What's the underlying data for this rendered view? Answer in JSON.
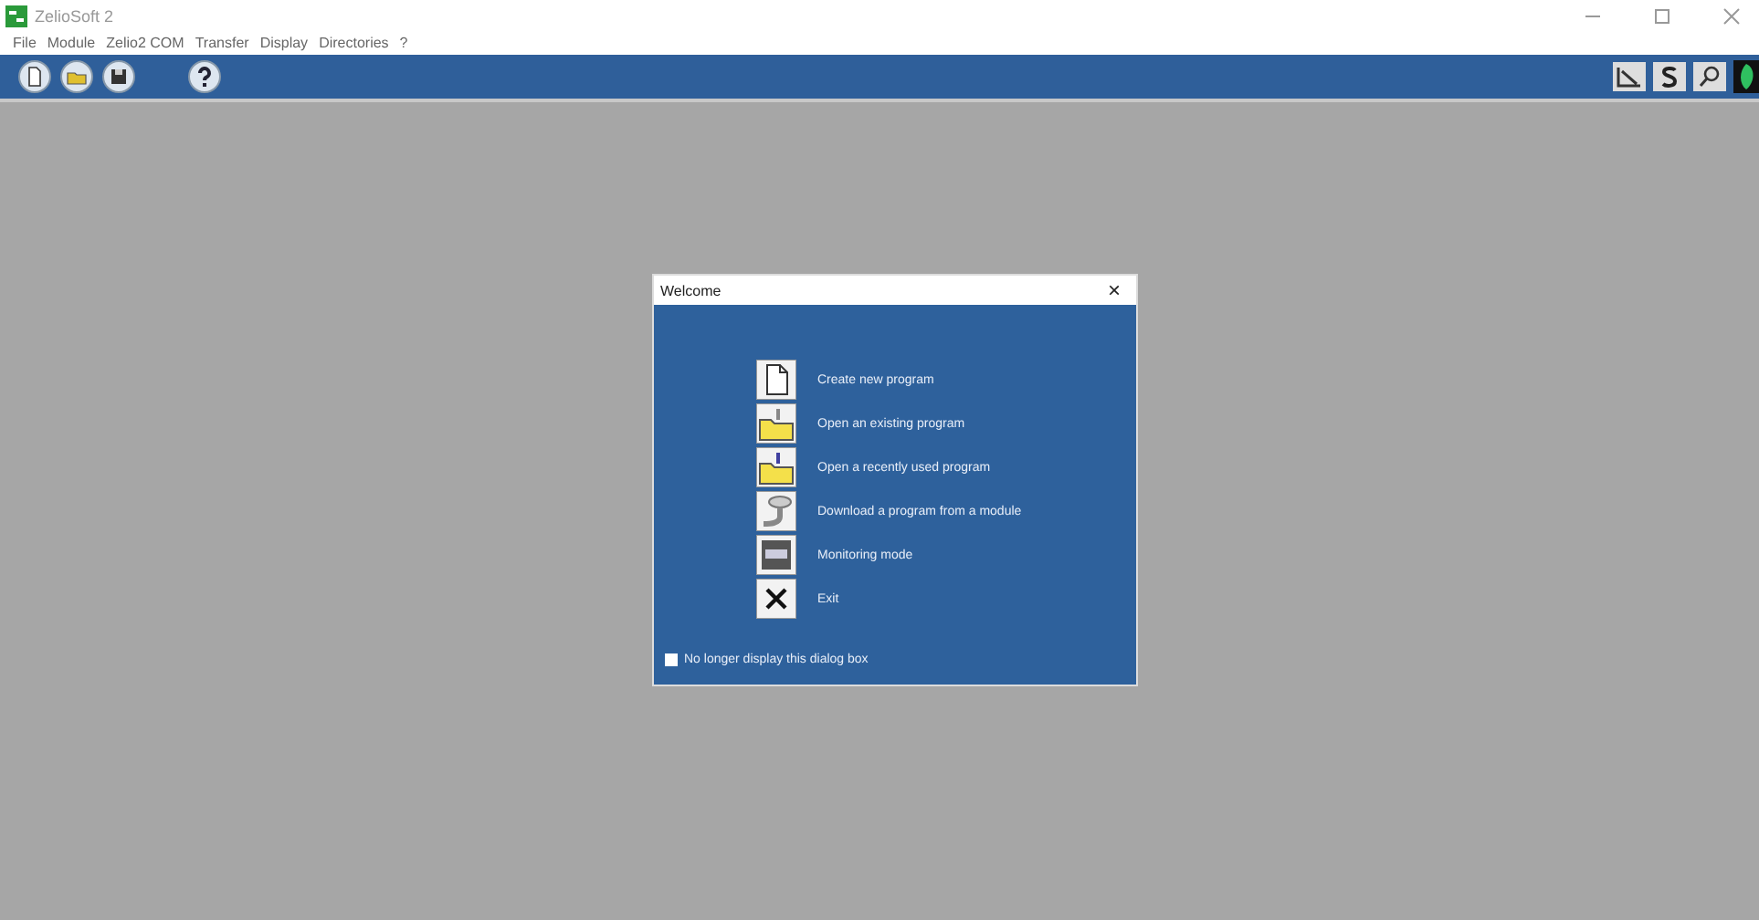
{
  "window": {
    "title": "ZelioSoft 2"
  },
  "menu": [
    "File",
    "Module",
    "Zelio2 COM",
    "Transfer",
    "Display",
    "Directories",
    "?"
  ],
  "dialog": {
    "title": "Welcome",
    "close": "×",
    "items": [
      {
        "kind": "new",
        "label": "Create new program"
      },
      {
        "kind": "open",
        "label": "Open an existing program"
      },
      {
        "kind": "recent",
        "label": "Open a recently used program"
      },
      {
        "kind": "download",
        "label": "Download a program from a module"
      },
      {
        "kind": "monitor",
        "label": "Monitoring mode"
      },
      {
        "kind": "exit",
        "label": "Exit"
      }
    ],
    "checkbox": {
      "label": "No longer display this dialog box",
      "checked": false
    }
  }
}
